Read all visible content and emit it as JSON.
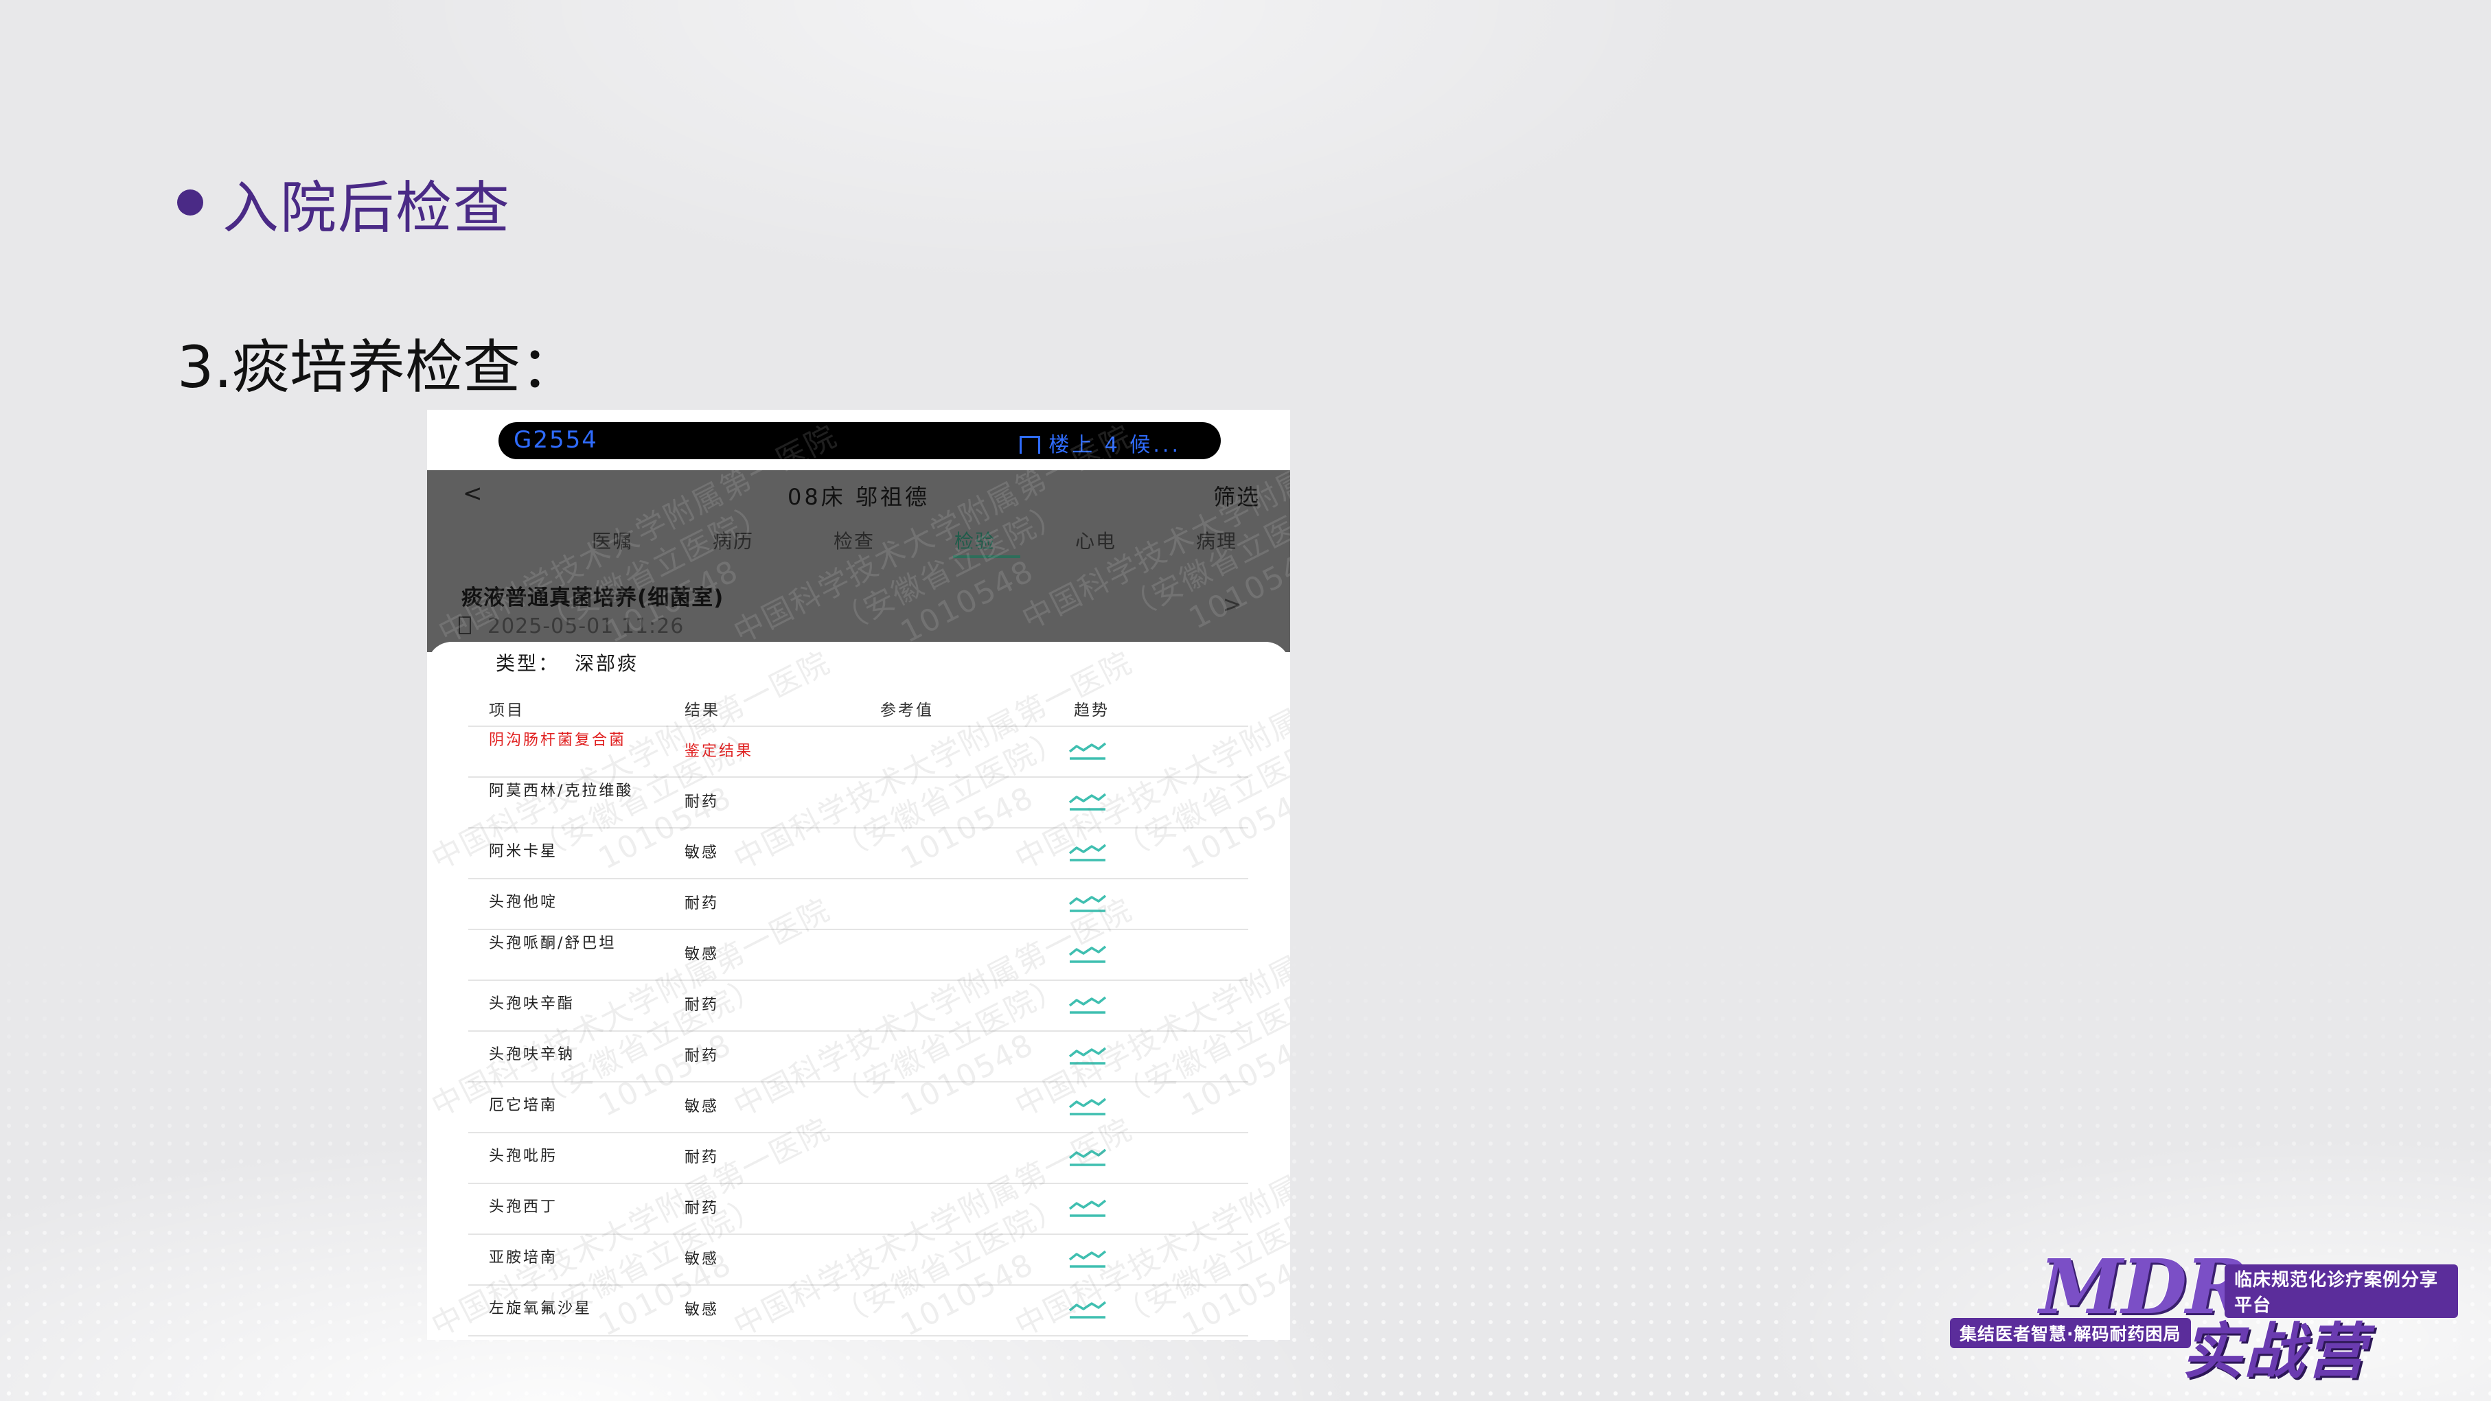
{
  "slide": {
    "heading": "入院后检查",
    "subheading": "3.痰培养检查："
  },
  "phone": {
    "status_left": "G2554",
    "status_right": "楼上 4 候...",
    "nav": {
      "back": "<",
      "title": "08床 邬祖德",
      "filter": "筛选"
    },
    "tabs": [
      "医嘱",
      "病历",
      "检查",
      "检验",
      "心电",
      "病理"
    ],
    "active_tab": "检验",
    "report": {
      "title": "痰液普通真菌培养(细菌室)",
      "time": "2025-05-01 11:26",
      "arrow": ">"
    },
    "type_label": "类型：",
    "type_value": "深部痰",
    "headers": {
      "item": "项目",
      "result": "结果",
      "reference": "参考值",
      "trend": "趋势"
    },
    "rows": [
      {
        "name": "阴沟肠杆菌复合菌",
        "result": "鉴定结果",
        "highlight": true
      },
      {
        "name": "阿莫西林/克拉维酸",
        "result": "耐药"
      },
      {
        "name": "阿米卡星",
        "result": "敏感"
      },
      {
        "name": "头孢他啶",
        "result": "耐药"
      },
      {
        "name": "头孢哌酮/舒巴坦",
        "result": "敏感"
      },
      {
        "name": "头孢呋辛酯",
        "result": "耐药"
      },
      {
        "name": "头孢呋辛钠",
        "result": "耐药"
      },
      {
        "name": "厄它培南",
        "result": "敏感"
      },
      {
        "name": "头孢吡肟",
        "result": "耐药"
      },
      {
        "name": "头孢西丁",
        "result": "耐药"
      },
      {
        "name": "亚胺培南",
        "result": "敏感"
      },
      {
        "name": "左旋氧氟沙星",
        "result": "敏感"
      }
    ],
    "watermark_lines": [
      "中国科学技术大学附属第一医院",
      "（安徽省立医院）",
      "1010548"
    ]
  },
  "logo": {
    "mdr": "MDR",
    "tagline_top": "临床规范化诊疗案例分享平台",
    "tagline_bottom": "集结医者智慧·解码耐药困局",
    "camp": "实战营"
  },
  "colors": {
    "heading": "#4a2a86",
    "highlight_red": "#e02020",
    "trend_teal": "#3fbfb0",
    "tab_active": "#2d6e5a",
    "brand_purple": "#5b2d9b"
  },
  "icons": {
    "trend": "trend-line-icon",
    "status": "building-icon",
    "time": "phone-icon"
  }
}
